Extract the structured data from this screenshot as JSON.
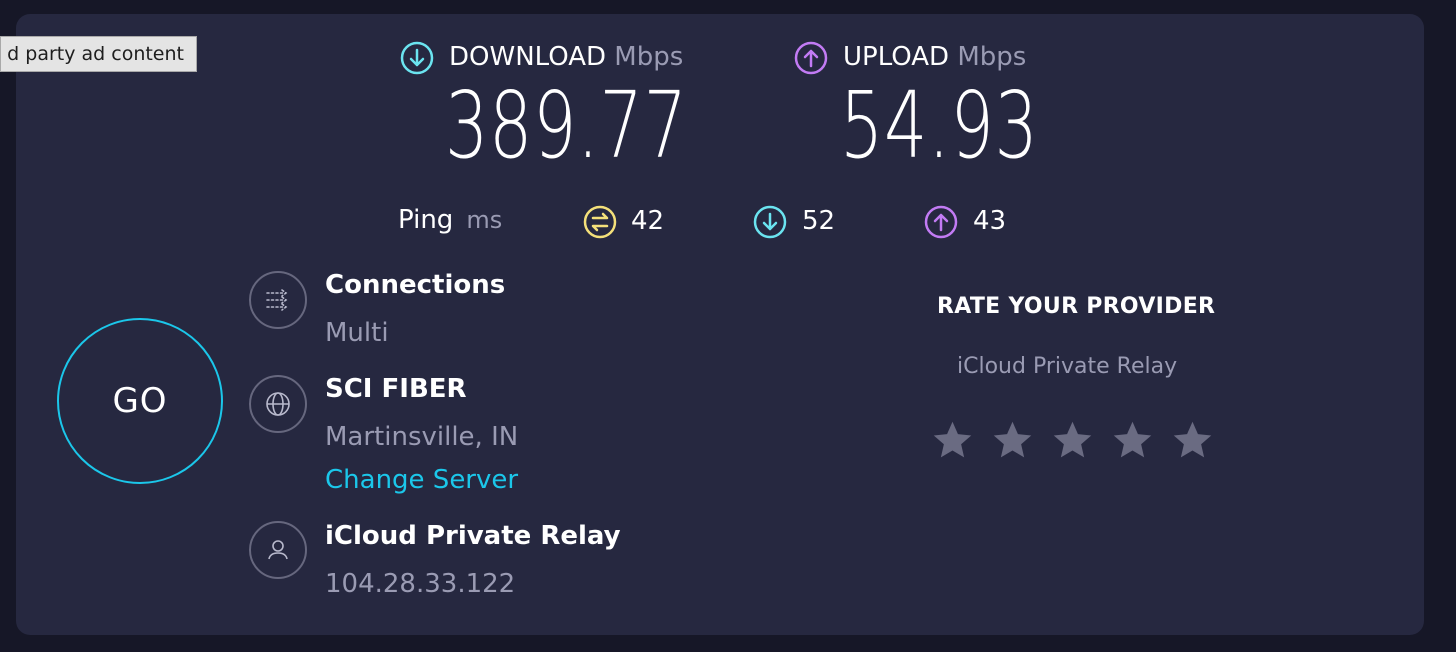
{
  "tooltip": {
    "text": "d party ad content"
  },
  "download": {
    "label": "DOWNLOAD",
    "unit": "Mbps",
    "value": "389.77",
    "icon": "download-arrow-icon",
    "color": "#6be4f0"
  },
  "upload": {
    "label": "UPLOAD",
    "unit": "Mbps",
    "value": "54.93",
    "icon": "upload-arrow-icon",
    "color": "#c27bf4"
  },
  "ping": {
    "label": "Ping",
    "unit": "ms",
    "idle": {
      "value": "42",
      "icon": "ping-idle-icon",
      "color": "#f4e07a"
    },
    "download": {
      "value": "52",
      "icon": "ping-download-icon",
      "color": "#6be4f0"
    },
    "upload": {
      "value": "43",
      "icon": "ping-upload-icon",
      "color": "#c27bf4"
    }
  },
  "go_button": {
    "label": "GO",
    "color": "#1bc7ea"
  },
  "connections": {
    "title": "Connections",
    "value": "Multi",
    "icon": "connections-icon"
  },
  "server": {
    "name": "SCI FIBER",
    "location": "Martinsville, IN",
    "change_label": "Change Server",
    "icon": "globe-icon"
  },
  "provider": {
    "name": "iCloud Private Relay",
    "ip": "104.28.33.122",
    "icon": "user-icon"
  },
  "rate": {
    "title": "RATE YOUR PROVIDER",
    "provider": "iCloud Private Relay",
    "stars_total": 5,
    "stars_filled": 0
  },
  "colors": {
    "background": "#161727",
    "panel": "#262840",
    "accent": "#1bc7ea",
    "muted": "#9a9bb3",
    "star": "#6a6b82"
  }
}
